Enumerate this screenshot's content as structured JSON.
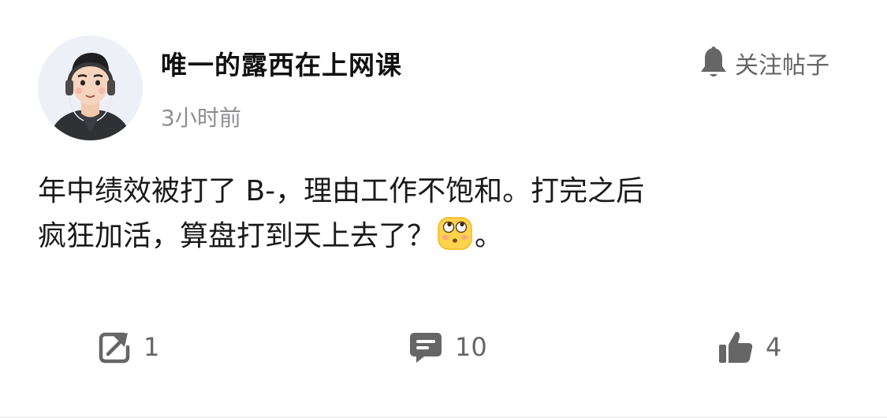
{
  "post": {
    "author": "唯一的露西在上网课",
    "time": "3小时前",
    "follow_label": "关注帖子",
    "content_line1": "年中绩效被打了 B-，理由工作不饱和。打完之后",
    "content_line2_text": "疯狂加活，算盘打到天上去了？",
    "content_line2_tail": "。",
    "emoji": "rolling-eyes-emoji"
  },
  "actions": {
    "share_count": "1",
    "comment_count": "10",
    "like_count": "4"
  },
  "colors": {
    "text": "#1a1a1a",
    "muted": "#8e8e93",
    "icon": "#666666"
  },
  "icons": [
    "avatar",
    "bell-icon",
    "share-icon",
    "comment-icon",
    "thumbs-up-icon"
  ]
}
